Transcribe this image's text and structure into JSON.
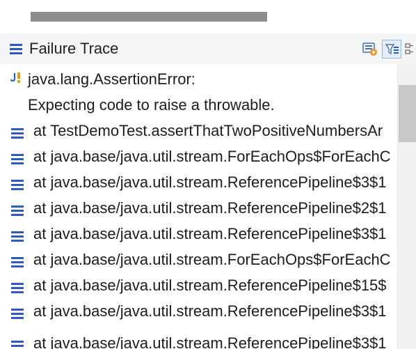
{
  "progress": {
    "value_percent": 100,
    "color": "#8c8c8c"
  },
  "header": {
    "title": "Failure Trace",
    "icons": {
      "view": "list-icon",
      "compare": "compare-results-icon",
      "filter": "filter-stack-trace-icon",
      "more": "more-actions-icon"
    }
  },
  "trace": {
    "rows": [
      {
        "text": "java.lang.AssertionError:",
        "icon": "junit-failure-icon"
      },
      {
        "text": "Expecting code to raise a throwable.",
        "icon": ""
      },
      {
        "text": "at TestDemoTest.assertThatTwoPositiveNumbersAr",
        "icon": "stack-frame-icon"
      },
      {
        "text": "at java.base/java.util.stream.ForEachOps$ForEachC",
        "icon": "stack-frame-icon"
      },
      {
        "text": "at java.base/java.util.stream.ReferencePipeline$3$1",
        "icon": "stack-frame-icon"
      },
      {
        "text": "at java.base/java.util.stream.ReferencePipeline$2$1",
        "icon": "stack-frame-icon"
      },
      {
        "text": "at java.base/java.util.stream.ReferencePipeline$3$1",
        "icon": "stack-frame-icon"
      },
      {
        "text": "at java.base/java.util.stream.ForEachOps$ForEachC",
        "icon": "stack-frame-icon"
      },
      {
        "text": "at java.base/java.util.stream.ReferencePipeline$15$",
        "icon": "stack-frame-icon"
      },
      {
        "text": "at java.base/java.util.stream.ReferencePipeline$3$1",
        "icon": "stack-frame-icon"
      },
      {
        "text": "at java.base/java.util.stream.ReferencePipeline$3$1",
        "icon": "stack-frame-icon"
      }
    ]
  },
  "colors": {
    "accent": "#2f5bb7",
    "header_bg": "#f4f5f6",
    "scroll_thumb": "#c8c8c8"
  }
}
